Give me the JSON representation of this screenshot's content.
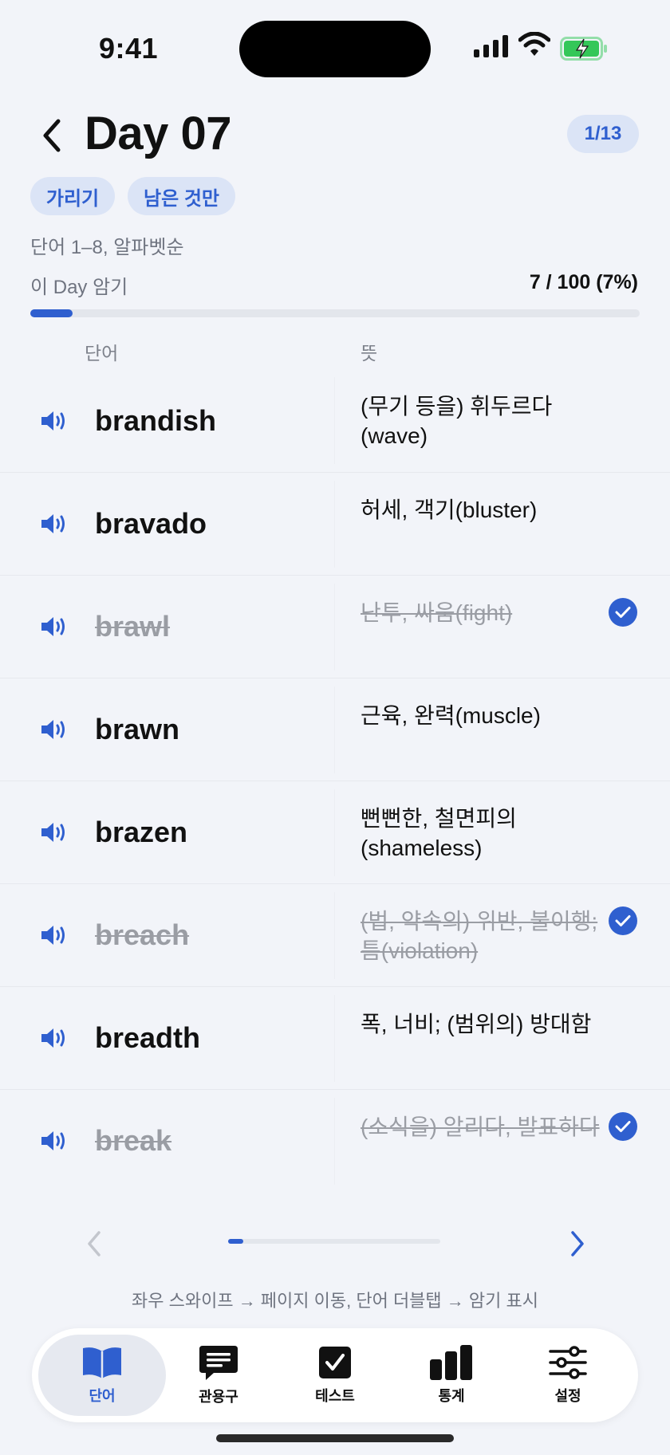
{
  "status": {
    "time": "9:41"
  },
  "header": {
    "title": "Day 07",
    "page_badge": "1/13",
    "chips": {
      "hide": "가리기",
      "remaining_only": "남은 것만"
    },
    "range_text": "단어 1–8, 알파벳순",
    "memo_label": "이 Day 암기",
    "memo_value": "7 / 100 (7%)",
    "memo_progress_percent": 7
  },
  "columns": {
    "word": "단어",
    "meaning": "뜻"
  },
  "words": [
    {
      "word": "brandish",
      "meaning": "(무기 등을) 휘두르다 (wave)",
      "memorized": false
    },
    {
      "word": "bravado",
      "meaning": "허세, 객기(bluster)",
      "memorized": false
    },
    {
      "word": "brawl",
      "meaning": "난투, 싸움(fight)",
      "memorized": true
    },
    {
      "word": "brawn",
      "meaning": "근육, 완력(muscle)",
      "memorized": false
    },
    {
      "word": "brazen",
      "meaning": "뻔뻔한, 철면피의 (shameless)",
      "memorized": false
    },
    {
      "word": "breach",
      "meaning": "(법, 약속의) 위반, 불이행; 틈(violation)",
      "memorized": true
    },
    {
      "word": "breadth",
      "meaning": "폭, 너비; (범위의) 방대함",
      "memorized": false
    },
    {
      "word": "break",
      "meaning": "(소식을) 알리다, 발표하다",
      "memorized": true
    }
  ],
  "pager": {
    "position_percent": 7
  },
  "hint": "좌우 스와이프 → 페이지 이동, 단어 더블탭 → 암기 표시",
  "tabs": [
    {
      "label": "단어",
      "icon": "book-icon",
      "active": true
    },
    {
      "label": "관용구",
      "icon": "chat-bubble-icon",
      "active": false
    },
    {
      "label": "테스트",
      "icon": "checkbox-icon",
      "active": false
    },
    {
      "label": "통계",
      "icon": "bar-chart-icon",
      "active": false
    },
    {
      "label": "설정",
      "icon": "sliders-icon",
      "active": false
    }
  ],
  "colors": {
    "accent": "#2f5fcf",
    "chip_bg": "#dbe4f6",
    "background": "#f2f4f9",
    "done_text": "#9a9da4"
  }
}
